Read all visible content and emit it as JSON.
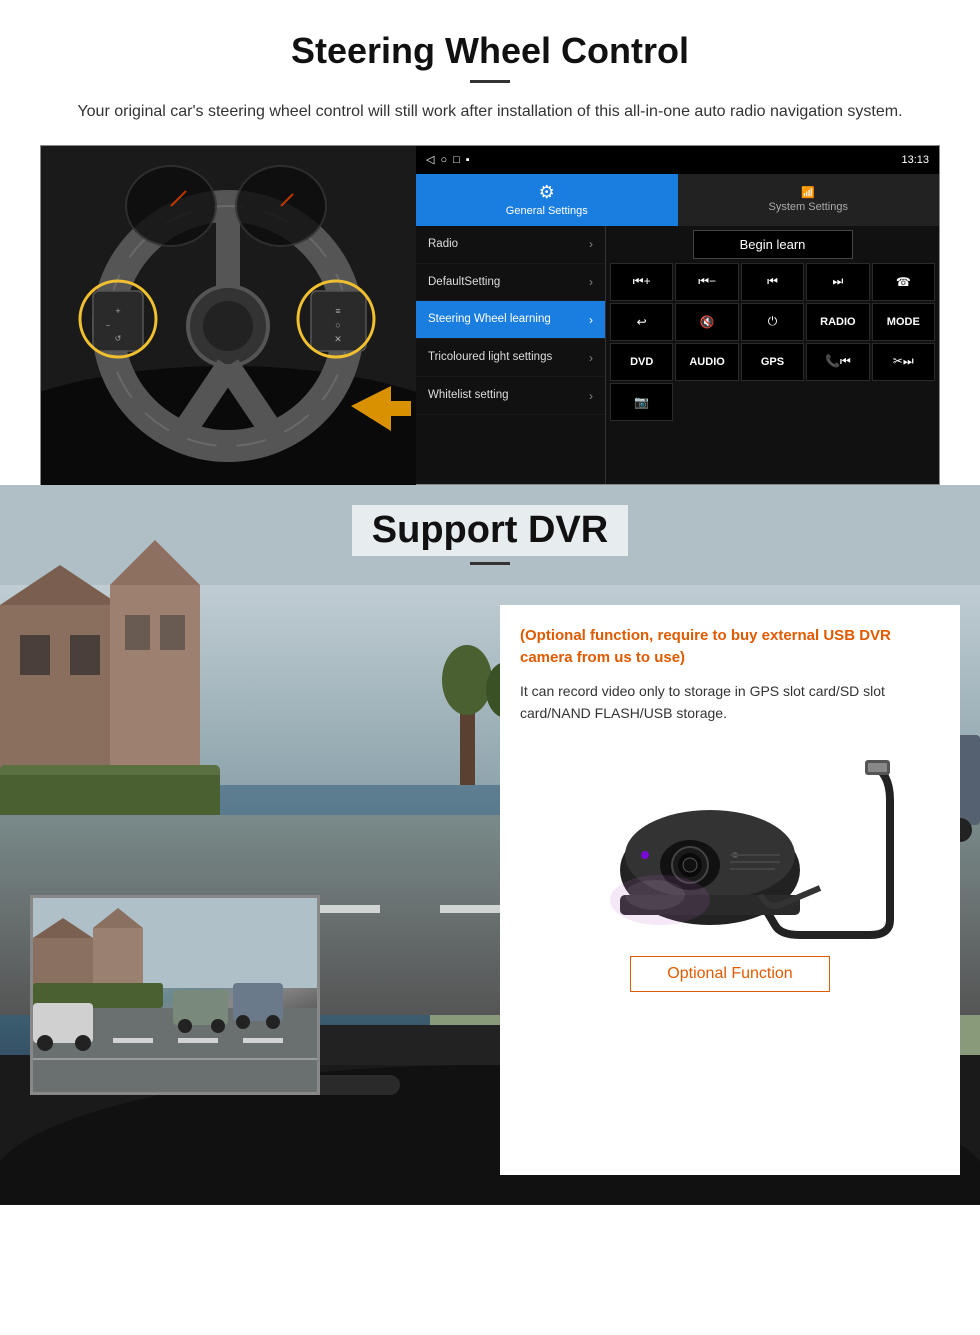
{
  "steering": {
    "title": "Steering Wheel Control",
    "description": "Your original car's steering wheel control will still work after installation of this all-in-one auto radio navigation system.",
    "statusbar": {
      "time": "13:13",
      "icons": "▷ ○ □ ■"
    },
    "tabs": {
      "general": "General Settings",
      "system": "System Settings"
    },
    "menu": [
      {
        "label": "Radio",
        "active": false
      },
      {
        "label": "DefaultSetting",
        "active": false
      },
      {
        "label": "Steering Wheel learning",
        "active": true
      },
      {
        "label": "Tricoloured light settings",
        "active": false
      },
      {
        "label": "Whitelist setting",
        "active": false
      }
    ],
    "begin_learn": "Begin learn",
    "controls": [
      {
        "type": "icon",
        "label": "⏮+"
      },
      {
        "type": "icon",
        "label": "⏮−"
      },
      {
        "type": "icon",
        "label": "⏮"
      },
      {
        "type": "icon",
        "label": "⏭"
      },
      {
        "type": "icon",
        "label": "☎"
      },
      {
        "type": "icon",
        "label": "↩"
      },
      {
        "type": "icon",
        "label": "🔇"
      },
      {
        "type": "icon",
        "label": "⏻"
      },
      {
        "type": "text",
        "label": "RADIO"
      },
      {
        "type": "text",
        "label": "MODE"
      },
      {
        "type": "text",
        "label": "DVD"
      },
      {
        "type": "text",
        "label": "AUDIO"
      },
      {
        "type": "text",
        "label": "GPS"
      },
      {
        "type": "icon",
        "label": "📞⏮"
      },
      {
        "type": "icon",
        "label": "✂⏭"
      },
      {
        "type": "icon",
        "label": "📷"
      }
    ]
  },
  "dvr": {
    "title": "Support DVR",
    "optional_text": "(Optional function, require to buy external USB DVR camera from us to use)",
    "description": "It can record video only to storage in GPS slot card/SD slot card/NAND FLASH/USB storage.",
    "optional_function_btn": "Optional Function"
  }
}
